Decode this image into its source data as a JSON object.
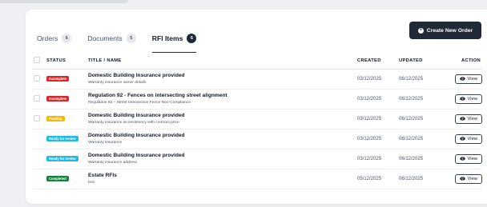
{
  "tabs": [
    {
      "label": "Orders",
      "count": "6",
      "active": false
    },
    {
      "label": "Documents",
      "count": "5",
      "active": false
    },
    {
      "label": "RFI Items",
      "count": "6",
      "active": true
    }
  ],
  "create_button": {
    "label": "Create New Order",
    "icon": "plus-circle-icon"
  },
  "table": {
    "headers": {
      "status": "STATUS",
      "title": "TITLE / NAME",
      "created": "CREATED",
      "updated": "UPDATED",
      "action": "ACTION"
    },
    "view_label": "View",
    "rows": [
      {
        "status": "Incomplete",
        "status_color": "#dc2626",
        "has_checkbox": true,
        "title": "Domestic Building Insurance provided",
        "subtitle": "Warranty insurance owner details",
        "created": "03/12/2025",
        "updated": "06/12/2025"
      },
      {
        "status": "Incomplete",
        "status_color": "#dc2626",
        "has_checkbox": true,
        "title": "Regulation 92 - Fences on intersecting street alignment",
        "subtitle": "Regulation 92 – Street Intersection Fence Non-Compliance",
        "created": "03/12/2025",
        "updated": "06/12/2025"
      },
      {
        "status": "Pending",
        "status_color": "#f5b800",
        "has_checkbox": true,
        "title": "Domestic Building Insurance provided",
        "subtitle": "Warranty insurance inconsistency with contract price",
        "created": "03/12/2025",
        "updated": "06/12/2025"
      },
      {
        "status": "Ready for review",
        "status_color": "#22b8e0",
        "has_checkbox": false,
        "title": "Domestic Building Insurance provided",
        "subtitle": "Warranty insurance",
        "created": "03/12/2025",
        "updated": "06/12/2025"
      },
      {
        "status": "Ready for review",
        "status_color": "#22b8e0",
        "has_checkbox": false,
        "title": "Domestic Building Insurance provided",
        "subtitle": "Warranty insurance address",
        "created": "03/12/2025",
        "updated": "06/12/2025"
      },
      {
        "status": "Completed",
        "status_color": "#15803d",
        "has_checkbox": false,
        "title": "Estate RFIs",
        "subtitle": "test",
        "created": "05/12/2025",
        "updated": "06/12/2025"
      }
    ]
  },
  "colors": {
    "primary": "#1f2937",
    "background": "#eef0f3"
  }
}
